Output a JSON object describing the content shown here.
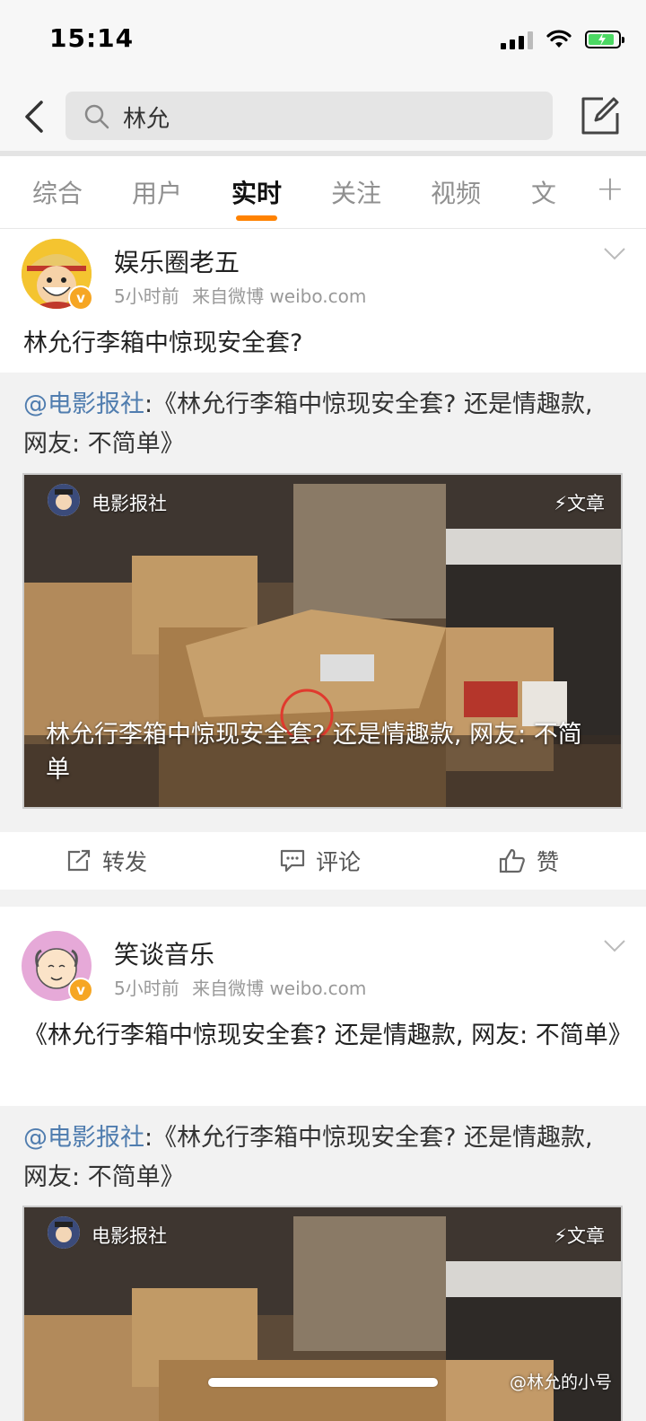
{
  "status": {
    "time": "15:14"
  },
  "search": {
    "query": "林允"
  },
  "tabs": [
    "综合",
    "用户",
    "实时",
    "关注",
    "视频",
    "文"
  ],
  "tab_plus": "+",
  "posts": [
    {
      "user": "娱乐圈老五",
      "time": "5小时前",
      "source": "来自微博 weibo.com",
      "text": "林允行李箱中惊现安全套?",
      "repost": {
        "mention": "@电影报社",
        "sep": ":",
        "text": "《林允行李箱中惊现安全套? 还是情趣款, 网友: 不简单》",
        "card_source": "电影报社",
        "card_badge": "文章",
        "card_caption": "林允行李箱中惊现安全套? 还是情趣款, 网友: 不简单"
      }
    },
    {
      "user": "笑谈音乐",
      "time": "5小时前",
      "source": "来自微博 weibo.com",
      "text": "《林允行李箱中惊现安全套? 还是情趣款, 网友: 不简单》",
      "repost": {
        "mention": "@电影报社",
        "sep": ":",
        "text": "《林允行李箱中惊现安全套? 还是情趣款, 网友: 不简单》",
        "card_source": "电影报社",
        "card_badge": "文章"
      }
    }
  ],
  "actions": {
    "repost": "转发",
    "comment": "评论",
    "like": "赞"
  },
  "watermark": "@林允的小号",
  "colors": {
    "accent": "#ff8200",
    "mention": "#507daf",
    "verified": "#f6a623"
  }
}
